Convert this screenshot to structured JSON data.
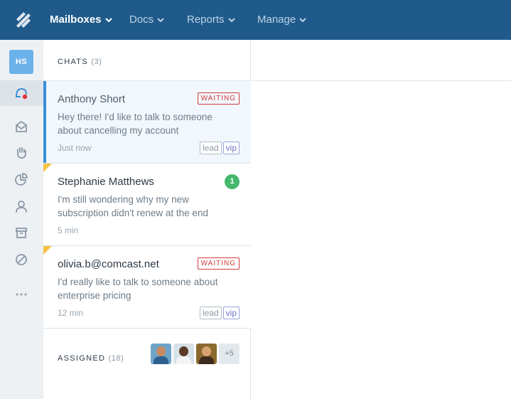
{
  "nav": {
    "items": [
      {
        "label": "Mailboxes",
        "active": true
      },
      {
        "label": "Docs",
        "active": false
      },
      {
        "label": "Reports",
        "active": false
      },
      {
        "label": "Manage",
        "active": false
      }
    ]
  },
  "rail": {
    "user_initials": "HS",
    "icons": [
      "chat-notification-icon",
      "inbox-icon",
      "hand-icon",
      "pie-chart-icon",
      "user-icon",
      "archive-icon",
      "blocked-icon",
      "more-dots-icon"
    ]
  },
  "chats": {
    "title": "CHATS",
    "count": "(3)",
    "items": [
      {
        "name": "Anthony Short",
        "preview": "Hey there! I'd like to talk to someone about cancelling my account",
        "time": "Just now",
        "status": "WAITING",
        "tags": [
          "lead",
          "vip"
        ]
      },
      {
        "name": "Stephanie Matthews",
        "preview": "I'm still wondering why my new subscription didn't renew at the end",
        "time": "5 min",
        "unread": "1"
      },
      {
        "name": "olivia.b@comcast.net",
        "preview": "I'd really like to talk to someone about enterprise pricing",
        "time": "12 min",
        "status": "WAITING",
        "tags": [
          "lead",
          "vip"
        ]
      }
    ]
  },
  "assigned": {
    "title": "ASSIGNED",
    "count": "(18)",
    "more": "+5"
  },
  "colors": {
    "topbar": "#1f5a8a",
    "accent": "#3a8fd6",
    "waiting": "#d33a3a",
    "unread": "#45b86e",
    "flag": "#f5c343",
    "vip": "#6c74c4"
  }
}
